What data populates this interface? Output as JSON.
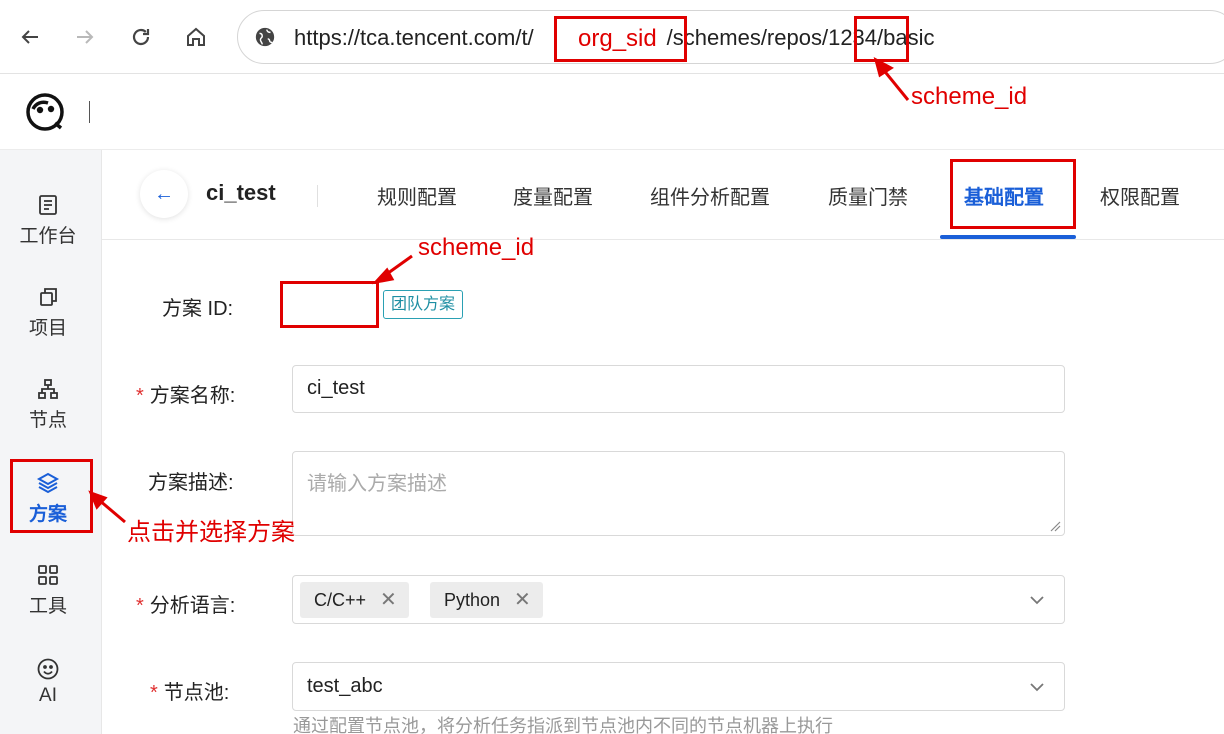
{
  "browser": {
    "url_prefix": "https://tca.tencent.com/t/",
    "url_middle": "/schemes/repos/",
    "url_scheme_id": "1234",
    "url_suffix": "/basic"
  },
  "header": {
    "logo": "tca-logo-icon"
  },
  "sidebar": {
    "items": [
      {
        "label": "工作台",
        "icon": "workbench-icon"
      },
      {
        "label": "项目",
        "icon": "project-icon"
      },
      {
        "label": "节点",
        "icon": "node-icon"
      },
      {
        "label": "方案",
        "icon": "layers-icon",
        "active": true
      },
      {
        "label": "工具",
        "icon": "grid-icon"
      },
      {
        "label": "AI",
        "icon": "smile-icon"
      }
    ]
  },
  "tabbar": {
    "back_icon": "←",
    "scheme_name": "ci_test",
    "tabs": [
      {
        "label": "规则配置"
      },
      {
        "label": "度量配置"
      },
      {
        "label": "组件分析配置"
      },
      {
        "label": "质量门禁"
      },
      {
        "label": "基础配置",
        "active": true
      },
      {
        "label": "权限配置"
      }
    ]
  },
  "form": {
    "scheme_id_label": "方案 ID:",
    "team_tag": "团队方案",
    "name_label": "方案名称:",
    "name_value": "ci_test",
    "desc_label": "方案描述:",
    "desc_placeholder": "请输入方案描述",
    "lang_label": "分析语言:",
    "languages": [
      "C/C++",
      "Python"
    ],
    "remove_symbol": "✕",
    "pool_label": "节点池:",
    "pool_value": "test_abc",
    "pool_help": "通过配置节点池，将分析任务指派到节点池内不同的节点机器上执行",
    "required_mark": "*"
  },
  "annotations": {
    "org_sid": "org_sid",
    "scheme_id_url": "scheme_id",
    "scheme_id_form": "scheme_id",
    "sidebar_hint": "点击并选择方案"
  },
  "colors": {
    "accent": "#1a5fd8",
    "annotation": "#e00000",
    "tag": "#1e8fa3"
  }
}
